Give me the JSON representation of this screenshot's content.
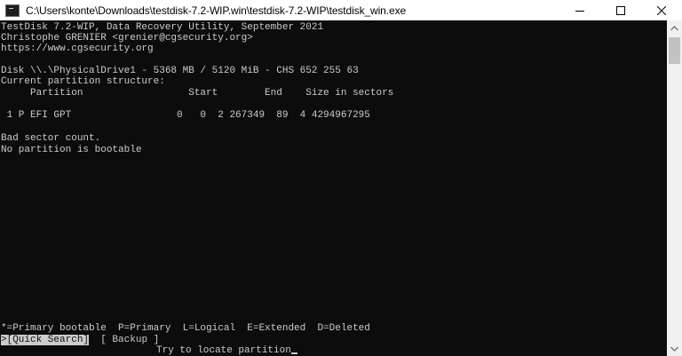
{
  "window": {
    "title": "C:\\Users\\konte\\Downloads\\testdisk-7.2-WIP.win\\testdisk-7.2-WIP\\testdisk_win.exe",
    "controls": {
      "minimize": "minimize-icon",
      "maximize": "maximize-icon",
      "close": "close-icon"
    }
  },
  "terminal": {
    "header": [
      "TestDisk 7.2-WIP, Data Recovery Utility, September 2021",
      "Christophe GRENIER <grenier@cgsecurity.org>",
      "https://www.cgsecurity.org"
    ],
    "disk_info": "Disk \\\\.\\PhysicalDrive1 - 5368 MB / 5120 MiB - CHS 652 255 63",
    "structure_label": "Current partition structure:",
    "table_header": "     Partition                  Start        End    Size in sectors",
    "partition_row": " 1 P EFI GPT                  0   0  2 267349  89  4 4294967295",
    "messages": [
      "Bad sector count.",
      "No partition is bootable"
    ],
    "legend": "*=Primary bootable  P=Primary  L=Logical  E=Extended  D=Deleted",
    "menu": {
      "quick_search": ">[Quick Search]",
      "backup": "[ Backup ]"
    },
    "hint": "Try to locate partition"
  },
  "colors": {
    "terminal_bg": "#0c0c0c",
    "terminal_fg": "#cccccc",
    "titlebar_bg": "#ffffff",
    "scrollbar_bg": "#f0f0f0"
  }
}
